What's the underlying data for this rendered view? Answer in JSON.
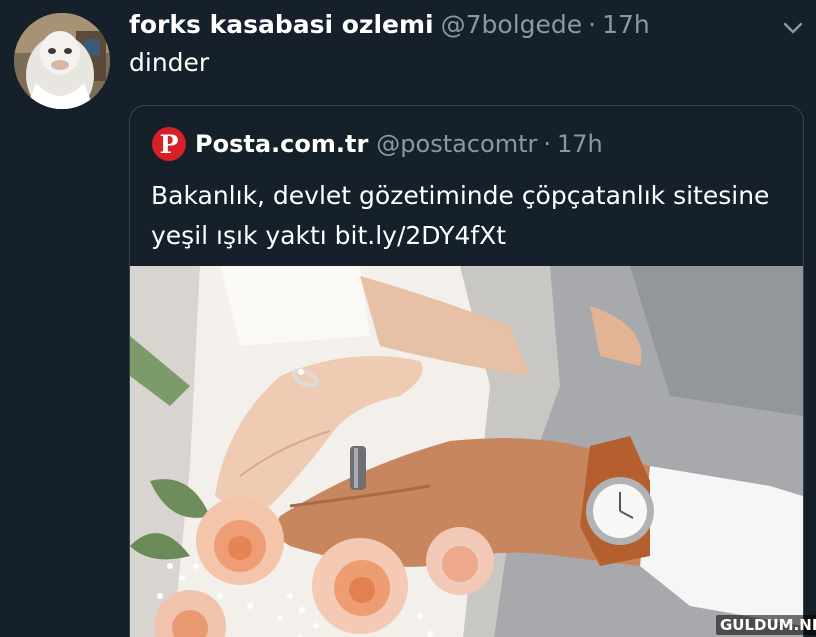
{
  "tweet": {
    "display_name": "forks kasabasi ozlemi",
    "handle": "@7bolgede",
    "separator": "·",
    "time": "17h",
    "text": "dinder",
    "avatar_icon": "white-hooded-avatar",
    "menu_icon": "chevron-down-icon"
  },
  "quoted_tweet": {
    "logo_letter": "P",
    "logo_color": "#d61f26",
    "display_name": "Posta.com.tr",
    "handle": "@postacomtr",
    "separator": "·",
    "time": "17h",
    "text": "Bakanlık, devlet gözetiminde çöpçatanlık sitesine yeşil ışık yaktı bit.ly/2DY4fXt",
    "image_subject": "wedding-hands-with-rings-and-bouquet"
  },
  "watermark": "GULDUM.NET",
  "colors": {
    "background": "#15202b",
    "secondary_text": "#8899a6",
    "border": "#38444d",
    "primary_text": "#ffffff"
  }
}
